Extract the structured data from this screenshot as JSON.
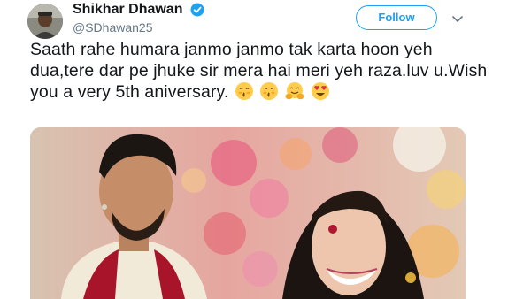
{
  "tweet": {
    "display_name": "Shikhar Dhawan",
    "handle": "@SDhawan25",
    "follow_label": "Follow",
    "text": "Saath rahe humara janmo janmo tak karta hoon yeh dua,tere dar pe jhuke sir mera hai meri yeh raza.luv u.Wish you a very 5th aniversary.",
    "emojis": [
      "kissing-face-icon",
      "kissing-face-icon",
      "hugging-face-icon",
      "heart-eyes-face-icon"
    ]
  },
  "colors": {
    "brand_blue": "#1da1f2",
    "handle_gray": "#657786",
    "text": "#14171a"
  }
}
